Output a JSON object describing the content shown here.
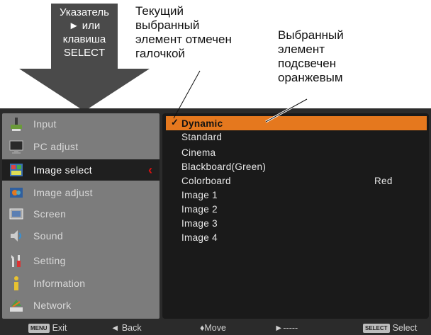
{
  "pointer": {
    "lines": [
      "Указатель",
      "► или",
      "клавиша",
      "SELECT"
    ]
  },
  "callout_current": {
    "lines": [
      "Текущий",
      "выбранный",
      "элемент отмечен",
      "галочкой"
    ]
  },
  "callout_highlight": {
    "lines": [
      "Выбранный",
      "элемент",
      "подсвечен",
      "оранжевым"
    ]
  },
  "menu": {
    "items": [
      {
        "label": "Input",
        "icon": "input-icon"
      },
      {
        "label": "PC adjust",
        "icon": "pc-adjust-icon"
      },
      {
        "label": "Image select",
        "icon": "image-select-icon",
        "active": true
      },
      {
        "label": "Image adjust",
        "icon": "image-adjust-icon"
      },
      {
        "label": "Screen",
        "icon": "screen-icon"
      },
      {
        "label": "Sound",
        "icon": "sound-icon"
      },
      {
        "label": "Setting",
        "icon": "setting-icon"
      },
      {
        "label": "Information",
        "icon": "information-icon"
      },
      {
        "label": "Network",
        "icon": "network-icon"
      }
    ],
    "options": [
      {
        "label": "Dynamic",
        "selected": true,
        "checkmark": "✓"
      },
      {
        "label": "Standard"
      },
      {
        "label": "Cinema"
      },
      {
        "label": "Blackboard(Green)"
      },
      {
        "label": "Colorboard",
        "value": "Red"
      },
      {
        "label": "Image 1"
      },
      {
        "label": "Image 2"
      },
      {
        "label": "Image 3"
      },
      {
        "label": "Image 4"
      }
    ]
  },
  "bottom_bar": {
    "menu_key": "MENU",
    "exit": "Exit",
    "back": "◄ Back",
    "move": "♦Move",
    "next": "►-----",
    "select_key": "SELECT",
    "select": "Select"
  },
  "colors": {
    "highlight": "#e5781e",
    "active_marker": "#dd1111"
  }
}
